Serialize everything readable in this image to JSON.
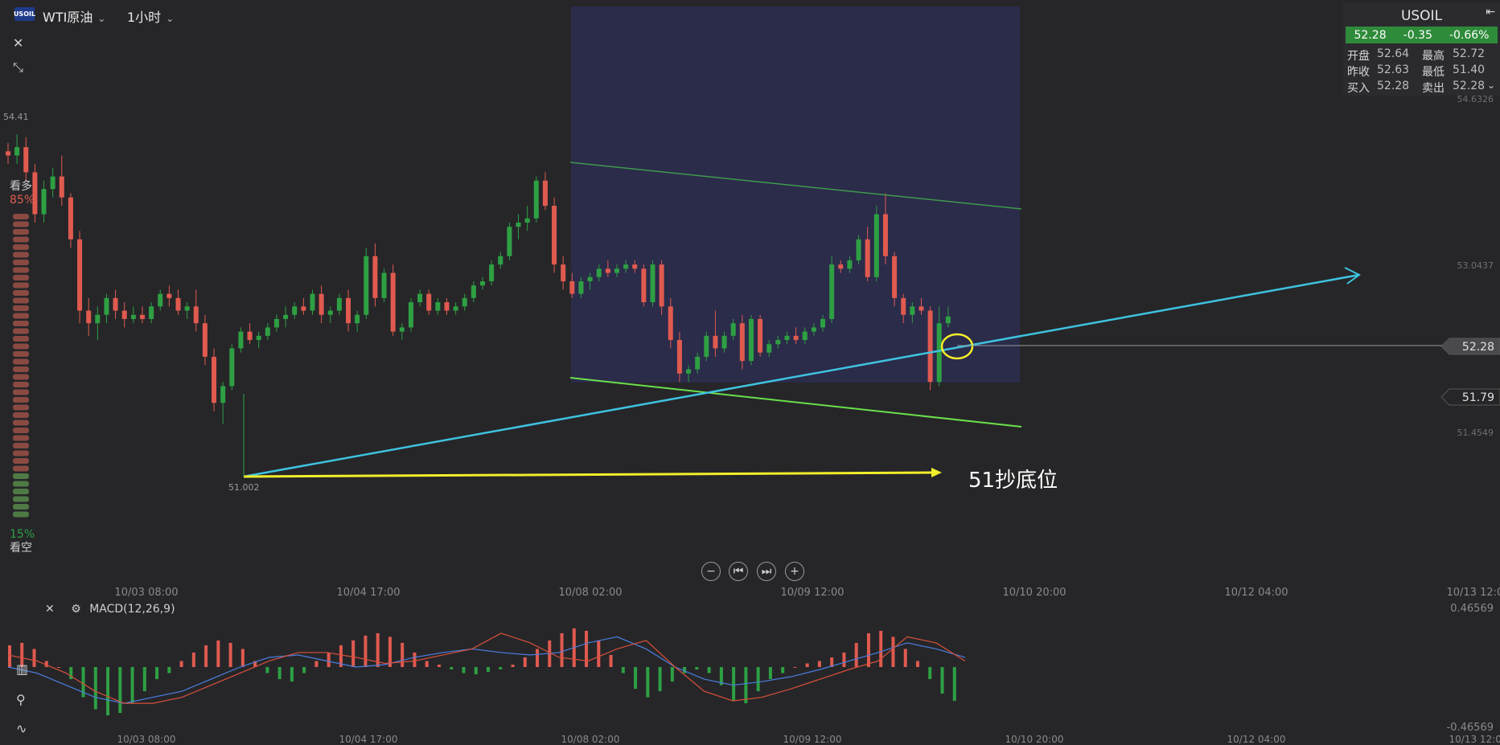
{
  "header": {
    "logo_text": "USOIL",
    "symbol_label": "WTI原油",
    "timeframe_label": "1小时",
    "chevron": "⌄"
  },
  "left_toolbar": {
    "close_glyph": "✕",
    "compress_glyph": "⤡"
  },
  "quote_panel": {
    "title": "USOIL",
    "last": "52.28",
    "change": "-0.35",
    "change_pct": "-0.66%",
    "open_label": "开盘",
    "open_value": "52.64",
    "high_label": "最高",
    "high_value": "52.72",
    "prev_close_label": "昨收",
    "prev_close_value": "52.63",
    "low_label": "最低",
    "low_value": "51.40",
    "bid_label": "买入",
    "bid_value": "52.28",
    "ask_label": "卖出",
    "ask_value": "52.28"
  },
  "sentiment": {
    "bull_label": "看多",
    "bull_pct": "85%",
    "bear_pct": "15%",
    "bear_label": "看空",
    "bull_fraction": 0.85
  },
  "colors": {
    "up": "#2ea043",
    "down": "#e05a4f",
    "trend_line": "#3ec3e0",
    "support_line": "#f2ee2a",
    "channel_upper": "#3e9a4d",
    "channel_lower": "#6be04a",
    "zone": "#2b2b4a",
    "macd_line": "#4b7fe0",
    "signal_line": "#d9503a"
  },
  "annotation": {
    "text": "51抄底位"
  },
  "nav_buttons": [
    "−",
    "⏮",
    "⏭",
    "+"
  ],
  "macd_panel": {
    "title": "MACD(12,26,9)",
    "top_value": "0.46569",
    "bottom_value": "-0.46569",
    "close_glyph": "✕",
    "gear_glyph": "⚙"
  },
  "chart_data": {
    "type": "candlestick",
    "instrument": "USOIL",
    "timeframe": "1h",
    "x_labels": [
      "10/03 08:00",
      "10/04 17:00",
      "10/08 02:00",
      "10/09 12:00",
      "10/10 20:00",
      "10/12 04:00",
      "10/13 12:00"
    ],
    "y_tick_labels": [
      "54.6326",
      "53.0437",
      "51.4549"
    ],
    "price_tags": [
      {
        "label": "52.28",
        "value": 52.28
      },
      {
        "label": "51.79",
        "value": 51.79
      }
    ],
    "high_marker": {
      "label": "54.41",
      "value": 54.41
    },
    "low_marker": {
      "label": "51.002",
      "value": 51.002
    },
    "ylim": [
      50.4,
      55.0
    ],
    "candles": [
      [
        54.25,
        54.35,
        54.1,
        54.2
      ],
      [
        54.2,
        54.45,
        54.1,
        54.3
      ],
      [
        54.3,
        54.42,
        53.9,
        54.0
      ],
      [
        54.0,
        54.1,
        53.4,
        53.5
      ],
      [
        53.5,
        53.9,
        53.4,
        53.8
      ],
      [
        53.8,
        54.05,
        53.7,
        53.95
      ],
      [
        53.95,
        54.2,
        53.6,
        53.7
      ],
      [
        53.7,
        53.75,
        53.1,
        53.2
      ],
      [
        53.2,
        53.3,
        52.2,
        52.35
      ],
      [
        52.35,
        52.5,
        52.05,
        52.2
      ],
      [
        52.2,
        52.4,
        52.0,
        52.3
      ],
      [
        52.3,
        52.55,
        52.2,
        52.5
      ],
      [
        52.5,
        52.6,
        52.25,
        52.35
      ],
      [
        52.35,
        52.45,
        52.15,
        52.25
      ],
      [
        52.25,
        52.4,
        52.2,
        52.3
      ],
      [
        52.3,
        52.4,
        52.2,
        52.25
      ],
      [
        52.25,
        52.45,
        52.2,
        52.4
      ],
      [
        52.4,
        52.6,
        52.35,
        52.55
      ],
      [
        52.55,
        52.65,
        52.4,
        52.5
      ],
      [
        52.5,
        52.6,
        52.3,
        52.35
      ],
      [
        52.35,
        52.45,
        52.25,
        52.4
      ],
      [
        52.4,
        52.6,
        52.1,
        52.2
      ],
      [
        52.2,
        52.3,
        51.7,
        51.8
      ],
      [
        51.8,
        51.9,
        51.15,
        51.25
      ],
      [
        51.25,
        51.5,
        51.0,
        51.45
      ],
      [
        51.45,
        51.95,
        51.4,
        51.9
      ],
      [
        51.9,
        52.15,
        51.85,
        52.1
      ],
      [
        52.1,
        52.2,
        51.95,
        52.0
      ],
      [
        52.0,
        52.1,
        51.9,
        52.05
      ],
      [
        52.05,
        52.2,
        52.0,
        52.15
      ],
      [
        52.15,
        52.3,
        52.1,
        52.25
      ],
      [
        52.25,
        52.4,
        52.15,
        52.3
      ],
      [
        52.3,
        52.45,
        52.25,
        52.4
      ],
      [
        52.4,
        52.5,
        52.3,
        52.35
      ],
      [
        52.35,
        52.6,
        52.3,
        52.55
      ],
      [
        52.55,
        52.65,
        52.2,
        52.3
      ],
      [
        52.3,
        52.4,
        52.2,
        52.35
      ],
      [
        52.35,
        52.55,
        52.3,
        52.5
      ],
      [
        52.5,
        52.6,
        52.1,
        52.2
      ],
      [
        52.2,
        52.35,
        52.1,
        52.3
      ],
      [
        52.3,
        53.1,
        52.25,
        53.0
      ],
      [
        53.0,
        53.15,
        52.4,
        52.5
      ],
      [
        52.5,
        52.85,
        52.45,
        52.8
      ],
      [
        52.8,
        52.9,
        52.05,
        52.1
      ],
      [
        52.1,
        52.2,
        52.0,
        52.15
      ],
      [
        52.15,
        52.5,
        52.1,
        52.45
      ],
      [
        52.45,
        52.6,
        52.4,
        52.55
      ],
      [
        52.55,
        52.6,
        52.3,
        52.35
      ],
      [
        52.35,
        52.5,
        52.3,
        52.45
      ],
      [
        52.45,
        52.5,
        52.3,
        52.35
      ],
      [
        52.35,
        52.45,
        52.3,
        52.4
      ],
      [
        52.4,
        52.55,
        52.35,
        52.5
      ],
      [
        52.5,
        52.7,
        52.45,
        52.65
      ],
      [
        52.65,
        52.75,
        52.6,
        52.7
      ],
      [
        52.7,
        52.95,
        52.65,
        52.9
      ],
      [
        52.9,
        53.05,
        52.85,
        53.0
      ],
      [
        53.0,
        53.4,
        52.95,
        53.35
      ],
      [
        53.35,
        53.5,
        53.2,
        53.4
      ],
      [
        53.4,
        53.6,
        53.3,
        53.45
      ],
      [
        53.45,
        53.95,
        53.4,
        53.9
      ],
      [
        53.9,
        54.0,
        53.55,
        53.6
      ],
      [
        53.6,
        53.7,
        52.8,
        52.9
      ],
      [
        52.9,
        53.0,
        52.6,
        52.7
      ],
      [
        52.7,
        52.8,
        52.5,
        52.55
      ],
      [
        52.55,
        52.75,
        52.5,
        52.7
      ],
      [
        52.7,
        52.8,
        52.6,
        52.75
      ],
      [
        52.75,
        52.9,
        52.7,
        52.85
      ],
      [
        52.85,
        52.95,
        52.75,
        52.8
      ],
      [
        52.8,
        52.9,
        52.75,
        52.85
      ],
      [
        52.85,
        52.95,
        52.8,
        52.9
      ],
      [
        52.9,
        52.95,
        52.8,
        52.85
      ],
      [
        52.85,
        52.9,
        52.4,
        52.45
      ],
      [
        52.45,
        52.95,
        52.4,
        52.9
      ],
      [
        52.9,
        52.95,
        52.3,
        52.4
      ],
      [
        52.4,
        52.5,
        51.9,
        52.0
      ],
      [
        52.0,
        52.1,
        51.5,
        51.6
      ],
      [
        51.6,
        51.7,
        51.5,
        51.65
      ],
      [
        51.65,
        51.85,
        51.6,
        51.8
      ],
      [
        51.8,
        52.1,
        51.75,
        52.05
      ],
      [
        52.05,
        52.35,
        51.8,
        51.9
      ],
      [
        51.9,
        52.1,
        51.85,
        52.05
      ],
      [
        52.05,
        52.25,
        52.0,
        52.2
      ],
      [
        52.2,
        52.3,
        51.65,
        51.75
      ],
      [
        51.75,
        52.3,
        51.7,
        52.25
      ],
      [
        52.25,
        52.3,
        51.8,
        51.85
      ],
      [
        51.85,
        52.0,
        51.8,
        51.95
      ],
      [
        51.95,
        52.05,
        51.9,
        52.0
      ],
      [
        52.0,
        52.1,
        51.95,
        52.05
      ],
      [
        52.05,
        52.15,
        51.95,
        52.0
      ],
      [
        52.0,
        52.15,
        51.95,
        52.1
      ],
      [
        52.1,
        52.2,
        52.05,
        52.15
      ],
      [
        52.15,
        52.3,
        52.1,
        52.25
      ],
      [
        52.25,
        53.0,
        52.2,
        52.9
      ],
      [
        52.9,
        52.95,
        52.8,
        52.85
      ],
      [
        52.85,
        53.0,
        52.8,
        52.95
      ],
      [
        52.95,
        53.25,
        52.9,
        53.2
      ],
      [
        53.2,
        53.35,
        52.7,
        52.75
      ],
      [
        52.75,
        53.6,
        52.7,
        53.5
      ],
      [
        53.5,
        53.75,
        52.9,
        53.0
      ],
      [
        53.0,
        53.05,
        52.4,
        52.5
      ],
      [
        52.5,
        52.55,
        52.2,
        52.3
      ],
      [
        52.3,
        52.45,
        52.2,
        52.4
      ],
      [
        52.4,
        52.5,
        52.3,
        52.35
      ],
      [
        52.35,
        52.4,
        51.4,
        51.5
      ],
      [
        51.5,
        52.4,
        51.45,
        52.2
      ],
      [
        52.2,
        52.4,
        52.15,
        52.28
      ]
    ],
    "macd": {
      "ylim": [
        -0.46569,
        0.46569
      ],
      "histogram": [
        0.18,
        0.2,
        0.15,
        0.05,
        0.0,
        -0.1,
        -0.25,
        -0.35,
        -0.4,
        -0.38,
        -0.3,
        -0.2,
        -0.1,
        -0.05,
        0.05,
        0.12,
        0.18,
        0.22,
        0.2,
        0.15,
        0.05,
        -0.05,
        -0.1,
        -0.12,
        -0.05,
        0.05,
        0.12,
        0.18,
        0.22,
        0.26,
        0.28,
        0.25,
        0.2,
        0.12,
        0.05,
        0.02,
        -0.02,
        -0.05,
        -0.06,
        -0.04,
        -0.02,
        0.02,
        0.08,
        0.15,
        0.22,
        0.28,
        0.32,
        0.3,
        0.22,
        0.1,
        -0.05,
        -0.18,
        -0.25,
        -0.2,
        -0.12,
        -0.05,
        -0.02,
        -0.05,
        -0.15,
        -0.28,
        -0.3,
        -0.2,
        -0.1,
        -0.05,
        0.0,
        0.03,
        0.05,
        0.08,
        0.12,
        0.2,
        0.28,
        0.3,
        0.25,
        0.15,
        0.05,
        -0.1,
        -0.22,
        -0.28
      ],
      "macd_line": [
        0.0,
        -0.05,
        -0.15,
        -0.25,
        -0.3,
        -0.25,
        -0.2,
        -0.1,
        0.0,
        0.08,
        0.1,
        0.05,
        0.0,
        0.02,
        0.08,
        0.12,
        0.15,
        0.12,
        0.1,
        0.12,
        0.2,
        0.25,
        0.15,
        0.0,
        -0.1,
        -0.15,
        -0.12,
        -0.08,
        -0.02,
        0.05,
        0.12,
        0.2,
        0.15,
        0.08
      ],
      "signal_line": [
        0.1,
        0.05,
        -0.05,
        -0.2,
        -0.3,
        -0.3,
        -0.25,
        -0.15,
        -0.05,
        0.05,
        0.12,
        0.12,
        0.08,
        0.03,
        0.05,
        0.1,
        0.15,
        0.28,
        0.2,
        0.08,
        0.05,
        0.15,
        0.22,
        0.0,
        -0.2,
        -0.28,
        -0.25,
        -0.18,
        -0.1,
        -0.02,
        0.05,
        0.25,
        0.2,
        0.05
      ]
    }
  }
}
